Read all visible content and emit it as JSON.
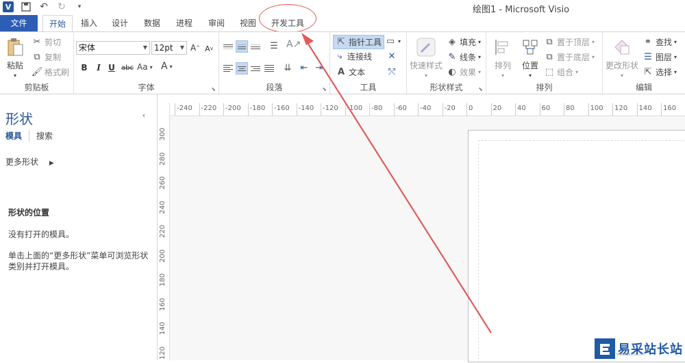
{
  "window": {
    "title": "绘图1 - Microsoft Visio"
  },
  "qat": {
    "logo_text": "V"
  },
  "tabs": [
    {
      "label": "文件"
    },
    {
      "label": "开始"
    },
    {
      "label": "插入"
    },
    {
      "label": "设计"
    },
    {
      "label": "数据"
    },
    {
      "label": "进程"
    },
    {
      "label": "审阅"
    },
    {
      "label": "视图"
    },
    {
      "label": "开发工具"
    }
  ],
  "ribbon": {
    "clipboard": {
      "label": "剪贴板",
      "paste": "粘贴",
      "cut": "剪切",
      "copy": "复制",
      "format_painter": "格式刷"
    },
    "font": {
      "label": "字体",
      "family": "宋体",
      "size": "12pt",
      "grow": "A",
      "shrink": "A",
      "bold": "B",
      "italic": "I",
      "underline": "U",
      "strike": "abc",
      "case": "Aa",
      "color": "A"
    },
    "paragraph": {
      "label": "段落"
    },
    "tools": {
      "label": "工具",
      "pointer": "指针工具",
      "connector": "连接线",
      "text": "文本"
    },
    "shape_styles": {
      "label": "形状样式",
      "quick_styles": "快速样式",
      "fill": "填充",
      "line": "线条",
      "effects": "效果"
    },
    "arrange": {
      "label": "排列",
      "align": "排列",
      "position": "位置",
      "bring_front": "置于顶层",
      "send_back": "置于底层",
      "group": "组合"
    },
    "editing": {
      "label": "编辑",
      "change_shape": "更改形状",
      "find": "查找",
      "layers": "图层",
      "select": "选择"
    }
  },
  "shapes_pane": {
    "title": "形状",
    "tab_stencils": "模具",
    "tab_search": "搜索",
    "more_shapes": "更多形状",
    "location_title": "形状的位置",
    "no_stencil": "没有打开的模具。",
    "hint": "单击上面的“更多形状”菜单可浏览形状类别并打开模具。"
  },
  "ruler_h": [
    "-240",
    "-220",
    "-200",
    "-180",
    "-160",
    "-140",
    "-120",
    "-100",
    "-80",
    "-60",
    "-40",
    "-20",
    "0",
    "20",
    "40",
    "60",
    "80",
    "100",
    "120",
    "140",
    "160"
  ],
  "ruler_v": [
    "300",
    "280",
    "260",
    "240",
    "220",
    "200",
    "180",
    "160",
    "140",
    "120"
  ],
  "watermark": {
    "text": "易采站长站",
    "url": "Www.Easck.Com"
  },
  "colors": {
    "accent": "#2b579a",
    "file_tab": "#2e5db5",
    "annotation": "#e25b5b"
  }
}
